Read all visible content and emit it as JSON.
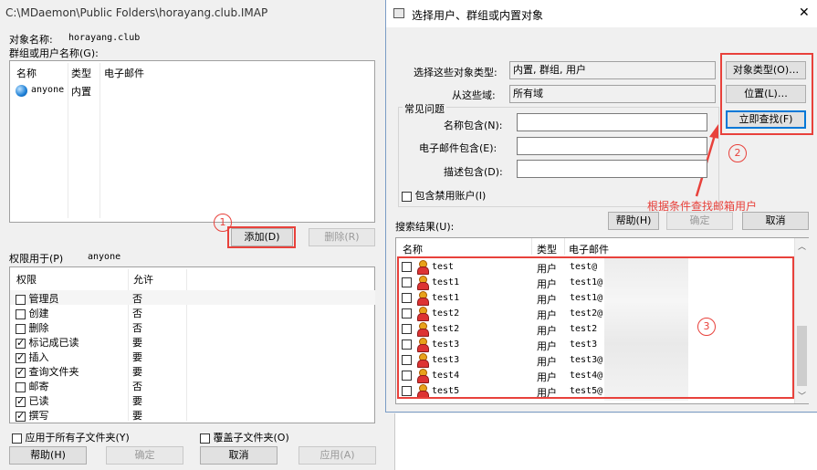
{
  "left": {
    "title": "C:\\MDaemon\\Public Folders\\horayang.club.IMAP",
    "object_name_label": "对象名称:",
    "object_name_value": "horayang.club",
    "group_label": "群组或用户名称(G):",
    "cols": [
      "名称",
      "类型",
      "电子邮件"
    ],
    "entry": {
      "name": "anyone",
      "type": "内置"
    },
    "add_btn": "添加(D)",
    "remove_btn": "删除(R)",
    "perm_for_label": "权限用于(P)",
    "perm_for_value": "anyone",
    "perm_cols": [
      "权限",
      "允许"
    ],
    "perms": [
      {
        "name": "管理员",
        "allow": "否"
      },
      {
        "name": "创建",
        "allow": "否"
      },
      {
        "name": "删除",
        "allow": "否"
      },
      {
        "name": "标记成已读",
        "allow": "要"
      },
      {
        "name": "插入",
        "allow": "要"
      },
      {
        "name": "查询文件夹",
        "allow": "要"
      },
      {
        "name": "邮寄",
        "allow": "否"
      },
      {
        "name": "已读",
        "allow": "要"
      },
      {
        "name": "撰写",
        "allow": "要"
      }
    ],
    "apply_sub": "应用于所有子文件夹(Y)",
    "override_sub": "覆盖子文件夹(O)",
    "help_btn": "帮助(H)",
    "ok_btn": "确定",
    "cancel_btn": "取消",
    "apply_btn": "应用(A)"
  },
  "dialog": {
    "title": "选择用户、群组或内置对象",
    "close": "✕",
    "obj_type_label": "选择这些对象类型:",
    "obj_type_value": "内置, 群组, 用户",
    "domain_label": "从这些域:",
    "domain_value": "所有域",
    "obj_type_btn": "对象类型(O)…",
    "location_btn": "位置(L)…",
    "find_now_btn": "立即查找(F)",
    "common_group": "常见问题",
    "name_contains": "名称包含(N):",
    "email_contains": "电子邮件包含(E):",
    "desc_contains": "描述包含(D):",
    "include_disabled": "包含禁用账户(I)",
    "help_btn": "帮助(H)",
    "ok_btn": "确定",
    "cancel_btn": "取消",
    "results_label": "搜索结果(U):",
    "res_cols": [
      "名称",
      "类型",
      "电子邮件"
    ],
    "results": [
      {
        "name": "test",
        "type": "用户",
        "email": "test@"
      },
      {
        "name": "test1",
        "type": "用户",
        "email": "test1@"
      },
      {
        "name": "test1",
        "type": "用户",
        "email": "test1@"
      },
      {
        "name": "test2",
        "type": "用户",
        "email": "test2@"
      },
      {
        "name": "test2",
        "type": "用户",
        "email": "test2"
      },
      {
        "name": "test3",
        "type": "用户",
        "email": "test3"
      },
      {
        "name": "test3",
        "type": "用户",
        "email": "test3@"
      },
      {
        "name": "test4",
        "type": "用户",
        "email": "test4@"
      },
      {
        "name": "test5",
        "type": "用户",
        "email": "test5@"
      }
    ]
  },
  "annotations": {
    "n1": "1",
    "n2": "2",
    "n3": "3",
    "note": "根据条件查找邮箱用户",
    "color": "#e8413b"
  }
}
